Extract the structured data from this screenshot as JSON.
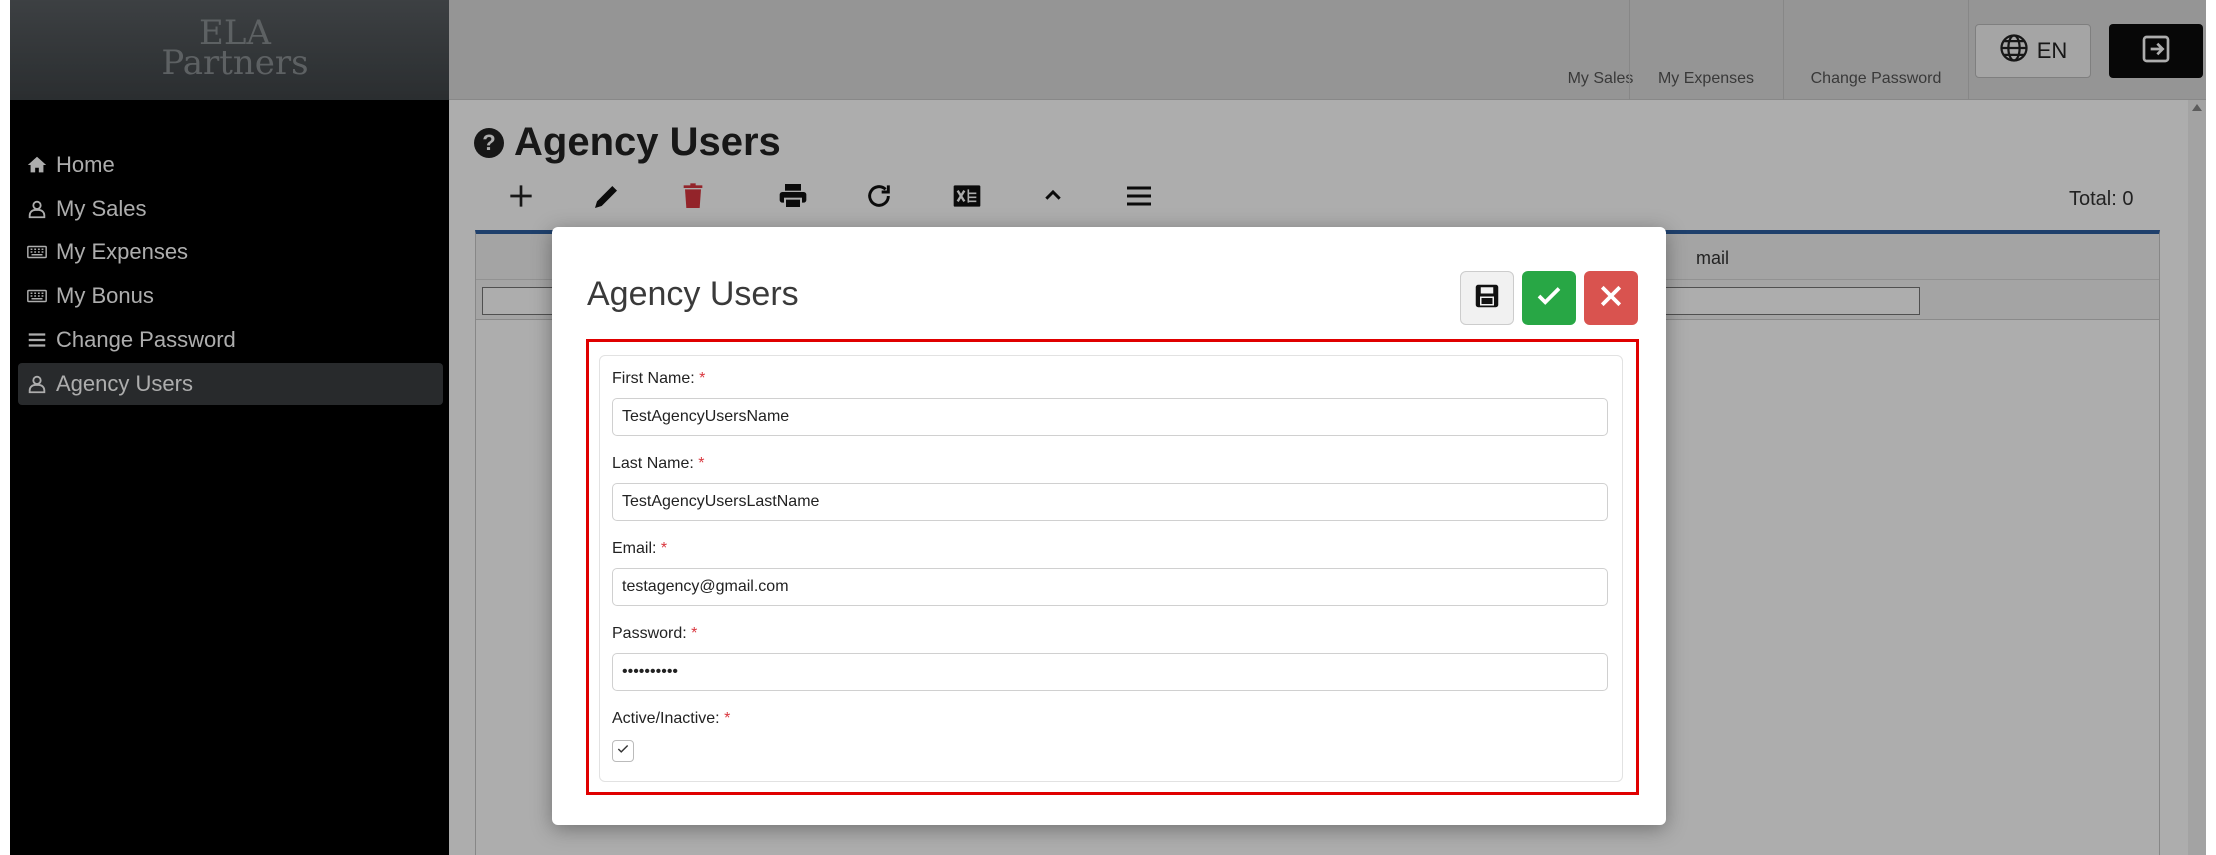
{
  "header": {
    "logo_line1": "ELA",
    "logo_line2": "Partners",
    "links": [
      "My Sales",
      "My Expenses",
      "Change Password"
    ],
    "language": "EN"
  },
  "sidebar": {
    "items": [
      {
        "label": "Home",
        "icon": "home-icon"
      },
      {
        "label": "My Sales",
        "icon": "user-icon"
      },
      {
        "label": "My Expenses",
        "icon": "keyboard-icon"
      },
      {
        "label": "My Bonus",
        "icon": "keyboard-icon"
      },
      {
        "label": "Change Password",
        "icon": "menu-lines-icon"
      },
      {
        "label": "Agency Users",
        "icon": "user-icon",
        "active": true
      }
    ]
  },
  "main": {
    "title": "Agency Users",
    "total_label": "Total: 0",
    "toolbar_icons": [
      "plus-icon",
      "pencil-icon",
      "trash-icon",
      "print-icon",
      "refresh-icon",
      "excel-icon",
      "chevron-up-icon",
      "menu-lines-icon"
    ],
    "grid_columns": [
      "Email"
    ],
    "grid_visible_column": "mail"
  },
  "dialog": {
    "title": "Agency Users",
    "fields": [
      {
        "label": "First Name:",
        "value": "TestAgencyUsersName"
      },
      {
        "label": "Last Name:",
        "value": "TestAgencyUsersLastName"
      },
      {
        "label": "Email:",
        "value": "testagency@gmail.com"
      },
      {
        "label": "Password:",
        "value": "••••••••••"
      }
    ],
    "active_label": "Active/Inactive:",
    "active_checked": true,
    "required_mark": "*"
  },
  "colors": {
    "accent_green": "#28a745",
    "accent_red": "#d9534f",
    "highlight_red": "#e00000",
    "sidebar_bg": "#000000",
    "grid_border_blue": "#2f5fa0"
  }
}
